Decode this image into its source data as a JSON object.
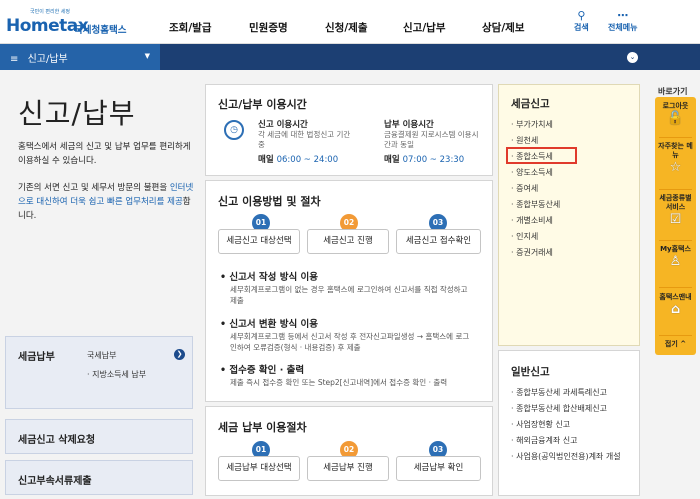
{
  "header": {
    "logo_tag": "국민이 편리한 세정",
    "logo_main": "Hometax",
    "logo_ko": "국세청홈택스",
    "nav": [
      "조회/발급",
      "민원증명",
      "신청/제출",
      "신고/납부",
      "상담/제보"
    ],
    "search_label": "검색",
    "menu_label": "전체메뉴"
  },
  "bar": {
    "selected": "신고/납부"
  },
  "left": {
    "title": "신고/납부",
    "intro1": "홈택스에서 세금의 신고 및 납부 업무를 편리하게 이용하실 수 있습니다.",
    "intro2_a": "기존의 서면 신고 및 세무서 방문의 불편을 ",
    "intro2_link": "인터넷으로 대신하여 더욱 쉽고 빠른 업무처리를 제공",
    "intro2_b": "합니다.",
    "pay_box": {
      "title": "세금납부",
      "items": [
        "국세납부",
        "지방소득세 납부"
      ]
    },
    "delete_box": "세금신고 삭제요청",
    "attach_box": "신고부속서류제출"
  },
  "hours": {
    "title": "신고/납부 이용시간",
    "report_title": "신고 이용시간",
    "report_desc": "각 세금에 대한 법정신고 기간 중",
    "report_time_label": "매일",
    "report_time": "06:00 ~ 24:00",
    "pay_title": "납부 이용시간",
    "pay_desc": "금융결제원 지로시스템 이용시간과 동일",
    "pay_time_label": "매일",
    "pay_time": "07:00 ~ 23:30"
  },
  "procedure": {
    "title": "신고 이용방법 및 절차",
    "steps": [
      {
        "num": "01",
        "label": "세금신고 대상선택"
      },
      {
        "num": "02",
        "label": "세금신고 진행"
      },
      {
        "num": "03",
        "label": "세금신고 접수확인"
      }
    ],
    "bullets": [
      {
        "title": "신고서 작성 방식 이용",
        "desc": "세무회계프로그램이 없는 경우 홈택스에 로그인하여 신고서를 직접 작성하고 제출"
      },
      {
        "title": "신고서 변환 방식 이용",
        "desc": "세무회계프로그램 등에서 신고서 작성 후 전자신고파일생성 → 홈택스에 로그인하여 오류검증(형식 · 내용검증) 후 제출"
      },
      {
        "title": "접수증 확인 · 출력",
        "desc": "제출 즉시 접수증 확인 또는 Step2[신고내역]에서 접수증 확인 · 출력"
      }
    ]
  },
  "payment": {
    "title": "세금 납부 이용절차",
    "steps": [
      {
        "num": "01",
        "label": "세금납부 대상선택"
      },
      {
        "num": "02",
        "label": "세금납부 진행"
      },
      {
        "num": "03",
        "label": "세금납부 확인"
      }
    ]
  },
  "tax_report": {
    "title": "세금신고",
    "items": [
      "부가가치세",
      "원천세",
      "종합소득세",
      "양도소득세",
      "증여세",
      "종합부동산세",
      "개별소비세",
      "인지세",
      "증권거래세"
    ],
    "highlighted": "종합소득세"
  },
  "general_report": {
    "title": "일반신고",
    "items": [
      "종합부동산세 과세특례신고",
      "종합부동산세 합산배제신고",
      "사업장현황 신고",
      "해외금융계좌 신고",
      "사업용(공익법인전용)계좌 개설"
    ]
  },
  "quick": {
    "label": "바로가기",
    "items": [
      {
        "label": "로그아웃",
        "icon": "unlock-icon",
        "glyph": "🔓"
      },
      {
        "label": "자주찾는 메뉴",
        "icon": "star-icon",
        "glyph": "☆"
      },
      {
        "label": "세금종류별 서비스",
        "icon": "checkbox-icon",
        "glyph": "☑"
      },
      {
        "label": "My홈택스",
        "icon": "person-icon",
        "glyph": "♙"
      },
      {
        "label": "홈택스맨내",
        "icon": "home-icon",
        "glyph": "⌂"
      },
      {
        "label": "접기",
        "icon": "chevron-up-icon",
        "glyph": "^"
      }
    ]
  },
  "colors": {
    "brand_blue": "#1a63b0",
    "bar_dark": "#1c3f73",
    "step_blue": "#2d6fb5",
    "step_orange": "#f29a36",
    "quick_yellow": "#f6b524",
    "highlight_red": "#e03a2c"
  }
}
